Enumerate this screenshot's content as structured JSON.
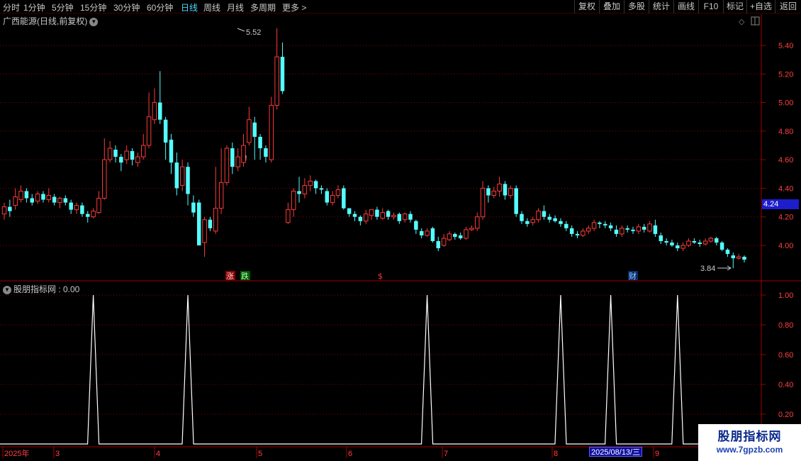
{
  "toolbar": {
    "periods": [
      "分时",
      "1分钟",
      "5分钟",
      "15分钟",
      "30分钟",
      "60分钟",
      "日线",
      "周线",
      "月线",
      "多周期",
      "更多"
    ],
    "active_period": "日线",
    "right_buttons": [
      "复权",
      "叠加",
      "多股",
      "统计",
      "画线",
      "F10",
      "标记",
      "+自选",
      "返回"
    ]
  },
  "stock": {
    "title": "广西能源(日线,前复权)",
    "high_label": "5.52",
    "low_label": "3.84",
    "current_price": "4.24"
  },
  "price_axis": {
    "ticks": [
      "5.40",
      "5.20",
      "5.00",
      "4.80",
      "4.60",
      "4.40",
      "4.20",
      "4.00"
    ]
  },
  "markers": {
    "zhang": "涨",
    "die": "跌",
    "dollar": "$",
    "cai": "财"
  },
  "indicator": {
    "title": "股朋指标网 : 0.00",
    "ticks": [
      "1.00",
      "0.80",
      "0.60",
      "0.40",
      "0.20"
    ]
  },
  "time_axis": {
    "labels": [
      "2025年",
      "3",
      "4",
      "5",
      "6",
      "7",
      "8",
      "9"
    ],
    "cursor_date": "2025/08/13/三"
  },
  "watermark": {
    "name": "股朋指标网",
    "url": "www.7gpzb.com"
  },
  "colors": {
    "up": "#ff3a3a",
    "down": "#54ffff",
    "grid": "#8b0000",
    "signal": "#ffffff"
  },
  "chart_data": [
    {
      "type": "candlestick",
      "title": "广西能源(日线,前复权)",
      "ylim": [
        3.7,
        5.55
      ],
      "candles": [
        [
          4.22,
          4.27,
          4.3,
          4.18
        ],
        [
          4.27,
          4.24,
          4.32,
          4.2
        ],
        [
          4.28,
          4.34,
          4.4,
          4.25
        ],
        [
          4.32,
          4.38,
          4.42,
          4.3
        ],
        [
          4.38,
          4.33,
          4.4,
          4.3
        ],
        [
          4.33,
          4.3,
          4.36,
          4.28
        ],
        [
          4.31,
          4.36,
          4.38,
          4.29
        ],
        [
          4.36,
          4.32,
          4.38,
          4.3
        ],
        [
          4.32,
          4.35,
          4.4,
          4.3
        ],
        [
          4.34,
          4.3,
          4.36,
          4.28
        ],
        [
          4.3,
          4.33,
          4.34,
          4.26
        ],
        [
          4.33,
          4.3,
          4.35,
          4.28
        ],
        [
          4.3,
          4.25,
          4.32,
          4.22
        ],
        [
          4.25,
          4.28,
          4.3,
          4.22
        ],
        [
          4.28,
          4.22,
          4.3,
          4.2
        ],
        [
          4.22,
          4.2,
          4.24,
          4.16
        ],
        [
          4.2,
          4.24,
          4.26,
          4.19
        ],
        [
          4.23,
          4.33,
          4.38,
          4.22
        ],
        [
          4.33,
          4.6,
          4.75,
          4.32
        ],
        [
          4.6,
          4.68,
          4.73,
          4.58
        ],
        [
          4.67,
          4.62,
          4.7,
          4.58
        ],
        [
          4.62,
          4.58,
          4.64,
          4.52
        ],
        [
          4.6,
          4.66,
          4.7,
          4.57
        ],
        [
          4.66,
          4.6,
          4.68,
          4.56
        ],
        [
          4.58,
          4.62,
          4.65,
          4.55
        ],
        [
          4.62,
          4.7,
          4.78,
          4.6
        ],
        [
          4.7,
          4.9,
          5.07,
          4.68
        ],
        [
          4.88,
          5.0,
          5.1,
          4.85
        ],
        [
          5.0,
          4.88,
          5.22,
          4.85
        ],
        [
          4.88,
          4.72,
          4.9,
          4.6
        ],
        [
          4.74,
          4.58,
          4.78,
          4.5
        ],
        [
          4.58,
          4.4,
          4.65,
          4.35
        ],
        [
          4.42,
          4.55,
          4.6,
          4.38
        ],
        [
          4.55,
          4.36,
          4.58,
          4.28
        ],
        [
          4.3,
          4.23,
          4.35,
          4.2
        ],
        [
          4.3,
          4.0,
          4.32,
          4.0
        ],
        [
          4.02,
          4.18,
          4.2,
          3.92
        ],
        [
          4.18,
          4.12,
          4.2,
          4.1
        ],
        [
          4.1,
          4.26,
          4.55,
          4.08
        ],
        [
          4.26,
          4.44,
          4.68,
          4.22
        ],
        [
          4.44,
          4.68,
          4.7,
          4.42
        ],
        [
          4.68,
          4.55,
          4.72,
          4.5
        ],
        [
          4.55,
          4.62,
          4.68,
          4.52
        ],
        [
          4.58,
          4.7,
          4.78,
          4.55
        ],
        [
          4.72,
          4.88,
          4.97,
          4.7
        ],
        [
          4.86,
          4.76,
          4.9,
          4.6
        ],
        [
          4.76,
          4.68,
          4.78,
          4.6
        ],
        [
          4.68,
          4.62,
          4.7,
          4.58
        ],
        [
          4.6,
          4.98,
          5.04,
          4.58
        ],
        [
          4.98,
          5.32,
          5.52,
          4.95
        ],
        [
          5.32,
          5.08,
          5.42,
          5.06
        ],
        [
          4.16,
          4.25,
          4.3,
          4.15
        ],
        [
          4.25,
          4.38,
          4.4,
          4.2
        ],
        [
          4.38,
          4.36,
          4.48,
          4.3
        ],
        [
          4.36,
          4.42,
          4.47,
          4.33
        ],
        [
          4.42,
          4.45,
          4.49,
          4.38
        ],
        [
          4.45,
          4.4,
          4.46,
          4.36
        ],
        [
          4.4,
          4.39,
          4.42,
          4.36
        ],
        [
          4.38,
          4.3,
          4.4,
          4.28
        ],
        [
          4.3,
          4.35,
          4.38,
          4.28
        ],
        [
          4.35,
          4.39,
          4.42,
          4.33
        ],
        [
          4.4,
          4.26,
          4.42,
          4.25
        ],
        [
          4.26,
          4.22,
          4.26,
          4.2
        ],
        [
          4.22,
          4.2,
          4.24,
          4.17
        ],
        [
          4.2,
          4.17,
          4.21,
          4.14
        ],
        [
          4.17,
          4.22,
          4.25,
          4.15
        ],
        [
          4.21,
          4.25,
          4.25,
          4.18
        ],
        [
          4.25,
          4.2,
          4.27,
          4.18
        ],
        [
          4.19,
          4.23,
          4.26,
          4.18
        ],
        [
          4.24,
          4.2,
          4.25,
          4.18
        ],
        [
          4.2,
          4.21,
          4.23,
          4.18
        ],
        [
          4.22,
          4.17,
          4.23,
          4.15
        ],
        [
          4.18,
          4.22,
          4.23,
          4.16
        ],
        [
          4.22,
          4.18,
          4.24,
          4.16
        ],
        [
          4.17,
          4.11,
          4.18,
          4.08
        ],
        [
          4.1,
          4.07,
          4.12,
          4.05
        ],
        [
          4.07,
          4.1,
          4.12,
          4.06
        ],
        [
          4.12,
          4.03,
          4.13,
          4.02
        ],
        [
          4.03,
          3.98,
          4.06,
          3.96
        ],
        [
          4.0,
          4.05,
          4.08,
          3.99
        ],
        [
          4.04,
          4.08,
          4.1,
          4.03
        ],
        [
          4.08,
          4.06,
          4.09,
          4.04
        ],
        [
          4.07,
          4.05,
          4.09,
          4.04
        ],
        [
          4.05,
          4.11,
          4.13,
          4.04
        ],
        [
          4.11,
          4.12,
          4.14,
          4.1
        ],
        [
          4.12,
          4.2,
          4.23,
          4.1
        ],
        [
          4.2,
          4.4,
          4.45,
          4.18
        ],
        [
          4.4,
          4.35,
          4.42,
          4.3
        ],
        [
          4.35,
          4.38,
          4.41,
          4.33
        ],
        [
          4.38,
          4.43,
          4.48,
          4.34
        ],
        [
          4.43,
          4.35,
          4.45,
          4.32
        ],
        [
          4.35,
          4.4,
          4.42,
          4.33
        ],
        [
          4.4,
          4.22,
          4.42,
          4.2
        ],
        [
          4.22,
          4.17,
          4.24,
          4.15
        ],
        [
          4.17,
          4.15,
          4.19,
          4.13
        ],
        [
          4.16,
          4.18,
          4.2,
          4.14
        ],
        [
          4.18,
          4.24,
          4.26,
          4.16
        ],
        [
          4.24,
          4.2,
          4.28,
          4.18
        ],
        [
          4.2,
          4.18,
          4.22,
          4.16
        ],
        [
          4.19,
          4.17,
          4.21,
          4.16
        ],
        [
          4.17,
          4.15,
          4.19,
          4.13
        ],
        [
          4.15,
          4.12,
          4.17,
          4.1
        ],
        [
          4.12,
          4.08,
          4.14,
          4.06
        ],
        [
          4.08,
          4.07,
          4.1,
          4.05
        ],
        [
          4.07,
          4.1,
          4.12,
          4.06
        ],
        [
          4.1,
          4.12,
          4.14,
          4.08
        ],
        [
          4.12,
          4.16,
          4.18,
          4.1
        ],
        [
          4.16,
          4.15,
          4.17,
          4.12
        ],
        [
          4.15,
          4.14,
          4.17,
          4.12
        ],
        [
          4.14,
          4.12,
          4.16,
          4.1
        ],
        [
          4.11,
          4.08,
          4.14,
          4.06
        ],
        [
          4.08,
          4.12,
          4.14,
          4.06
        ],
        [
          4.12,
          4.11,
          4.14,
          4.09
        ],
        [
          4.11,
          4.1,
          4.13,
          4.08
        ],
        [
          4.1,
          4.13,
          4.15,
          4.08
        ],
        [
          4.13,
          4.11,
          4.15,
          4.09
        ],
        [
          4.1,
          4.15,
          4.17,
          4.09
        ],
        [
          4.14,
          4.08,
          4.18,
          4.06
        ],
        [
          4.07,
          4.03,
          4.09,
          4.01
        ],
        [
          4.03,
          4.02,
          4.05,
          4.0
        ],
        [
          4.02,
          4.0,
          4.04,
          3.99
        ],
        [
          4.0,
          3.98,
          4.02,
          3.96
        ],
        [
          3.98,
          4.0,
          4.02,
          3.96
        ],
        [
          4.0,
          4.03,
          4.05,
          3.99
        ],
        [
          4.03,
          4.02,
          4.05,
          4.01
        ],
        [
          4.02,
          4.01,
          4.04,
          3.99
        ],
        [
          4.01,
          4.03,
          4.05,
          4.0
        ],
        [
          4.03,
          4.05,
          4.06,
          4.02
        ],
        [
          4.05,
          4.02,
          4.06,
          4.0
        ],
        [
          4.02,
          3.97,
          4.03,
          3.96
        ],
        [
          3.97,
          3.94,
          3.98,
          3.92
        ],
        [
          3.93,
          3.91,
          3.95,
          3.84
        ],
        [
          3.91,
          3.92,
          3.94,
          3.9
        ],
        [
          3.92,
          3.9,
          3.93,
          3.88
        ]
      ]
    },
    {
      "type": "line",
      "title": "股朋指标网 : 0.00",
      "ylim": [
        0,
        1
      ],
      "x_peaks": [
        16,
        33,
        76,
        100,
        109,
        121
      ],
      "values_at_peaks": 1.0,
      "baseline": 0.0
    }
  ]
}
